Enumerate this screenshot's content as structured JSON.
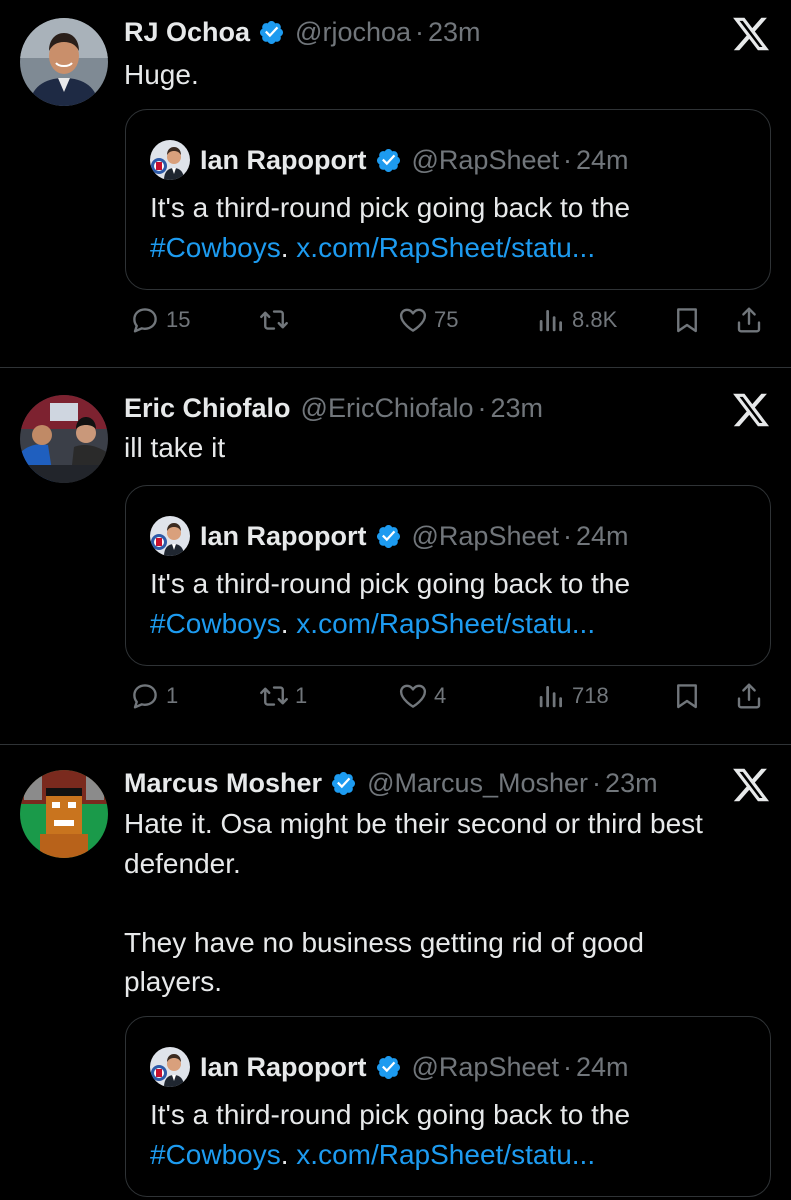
{
  "colors": {
    "background": "#000000",
    "text": "#e7e9ea",
    "muted": "#71767b",
    "link": "#1d9bf0",
    "verified": "#1d9bf0",
    "border": "#2f3336"
  },
  "icons": [
    "verified-badge-icon",
    "x-logo-icon",
    "reply-icon",
    "retweet-icon",
    "like-icon",
    "views-icon",
    "bookmark-icon",
    "share-icon"
  ],
  "quoted": {
    "name": "Ian Rapoport",
    "handle": "@RapSheet",
    "time": "24m",
    "text": "It's a third-round pick going back to the ",
    "hashtag": "#Cowboys",
    "sep": ". ",
    "link": "x.com/RapSheet/statu..."
  },
  "tweets": [
    {
      "name": "RJ Ochoa",
      "handle": "@rjochoa",
      "time": "23m",
      "verified": true,
      "text": "Huge.",
      "stats": {
        "replies": "15",
        "retweets": "",
        "likes": "75",
        "views": "8.8K"
      }
    },
    {
      "name": "Eric Chiofalo",
      "handle": "@EricChiofalo",
      "time": "23m",
      "verified": false,
      "text": "ill take it",
      "stats": {
        "replies": "1",
        "retweets": "1",
        "likes": "4",
        "views": "718"
      }
    },
    {
      "name": "Marcus Mosher",
      "handle": "@Marcus_Mosher",
      "time": "23m",
      "verified": true,
      "text": "Hate it. Osa might be their second or third best\ndefender.\n\nThey have no business getting rid of good\nplayers."
    }
  ]
}
